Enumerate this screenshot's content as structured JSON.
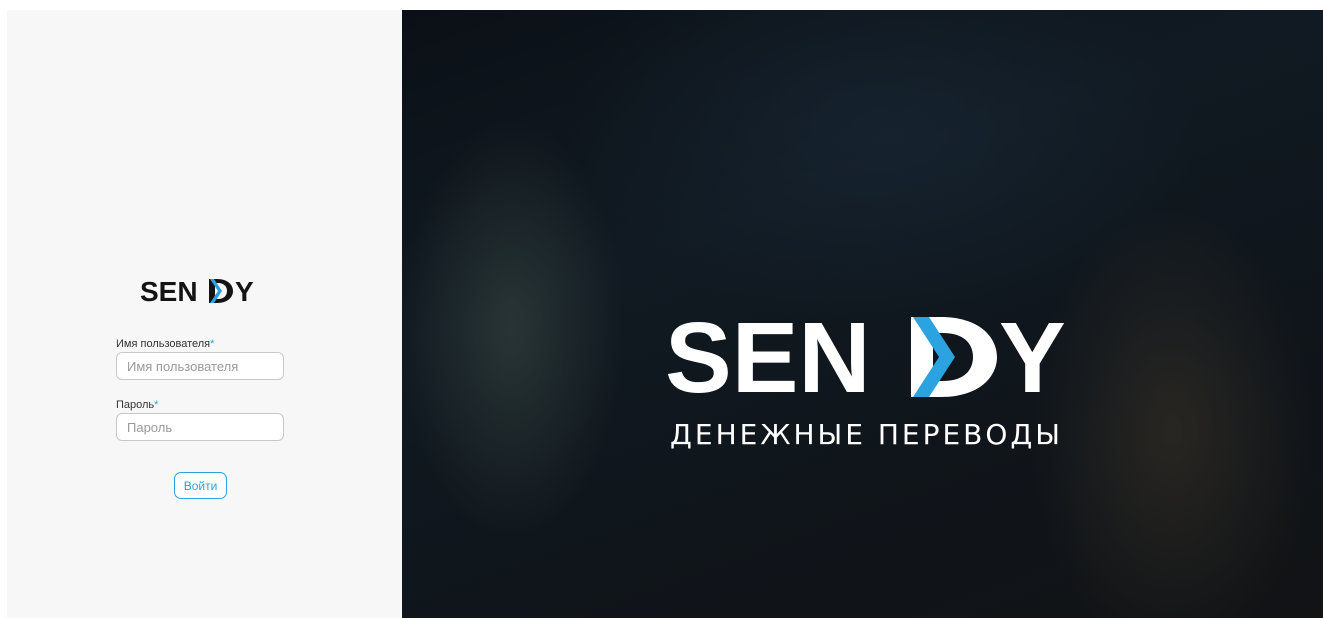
{
  "brand": {
    "name": "SENDY",
    "tagline": "ДЕНЕЖНЫЕ ПЕРЕВОДЫ",
    "accent_color": "#2aa3e0"
  },
  "login_form": {
    "username": {
      "label": "Имя пользователя",
      "required_mark": "*",
      "placeholder": "Имя пользователя",
      "value": ""
    },
    "password": {
      "label": "Пароль",
      "required_mark": "*",
      "placeholder": "Пароль",
      "value": ""
    },
    "submit_label": "Войти"
  }
}
